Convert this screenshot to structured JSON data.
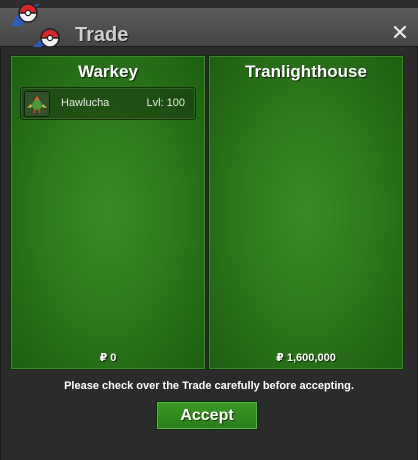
{
  "window": {
    "title": "Trade",
    "close_glyph": "✕",
    "logo_icon": "pokeball-logo-icon"
  },
  "left_panel": {
    "name": "Warkey",
    "items": [
      {
        "name": "Hawlucha",
        "level": "Lvl: 100",
        "icon": "hawlucha-sprite-icon"
      }
    ],
    "money": "₽ 0"
  },
  "right_panel": {
    "name": "Tranlighthouse",
    "items": [],
    "money": "₽ 1,600,000"
  },
  "footer": {
    "notice": "Please check over the Trade carefully before accepting.",
    "accept_label": "Accept"
  },
  "colors": {
    "panel_green": "#2e7a1c",
    "button_green": "#3a9a26",
    "window_bg": "#2b2b2b"
  }
}
